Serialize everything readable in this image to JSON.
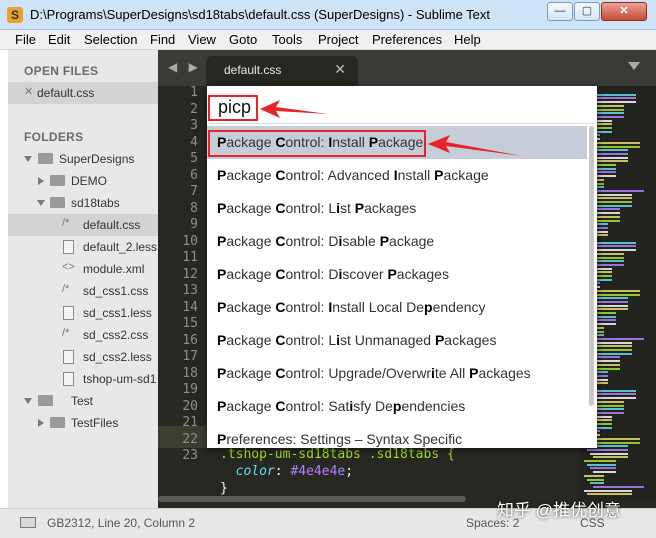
{
  "window": {
    "title": "D:\\Programs\\SuperDesigns\\sd18tabs\\default.css (SuperDesigns) - Sublime Text",
    "app_icon": "S",
    "min_glyph": "—",
    "max_glyph": "▢",
    "close_glyph": "✕"
  },
  "menu": [
    "File",
    "Edit",
    "Selection",
    "Find",
    "View",
    "Goto",
    "Tools",
    "Project",
    "Preferences",
    "Help"
  ],
  "sidebar": {
    "open_files_header": "OPEN FILES",
    "open_files": [
      {
        "label": "default.css",
        "glyph": "✕"
      }
    ],
    "folders_header": "FOLDERS",
    "tree": [
      {
        "label": "SuperDesigns",
        "kind": "folder",
        "expanded": true
      },
      {
        "label": "DEMO",
        "kind": "folder",
        "expanded": false
      },
      {
        "label": "sd18tabs",
        "kind": "folder",
        "expanded": true
      },
      {
        "label": "default.css",
        "kind": "css",
        "glyph": "/*"
      },
      {
        "label": "default_2.less",
        "kind": "file"
      },
      {
        "label": "module.xml",
        "kind": "xml",
        "glyph": "<>"
      },
      {
        "label": "sd_css1.css",
        "kind": "css",
        "glyph": "/*"
      },
      {
        "label": "sd_css1.less",
        "kind": "file"
      },
      {
        "label": "sd_css2.css",
        "kind": "css",
        "glyph": "/*"
      },
      {
        "label": "sd_css2.less",
        "kind": "file"
      },
      {
        "label": "tshop-um-sd1",
        "kind": "file"
      },
      {
        "label": "Test",
        "kind": "folder",
        "expanded": true
      },
      {
        "label": "TestFiles",
        "kind": "folder",
        "expanded": false
      }
    ]
  },
  "tabs": {
    "nav": "◀ ▶",
    "active": {
      "label": "default.css",
      "close": "✕"
    }
  },
  "editor": {
    "line_numbers": [
      "1",
      "2",
      "3",
      "4",
      "5",
      "6",
      "7",
      "8",
      "9",
      "10",
      "11",
      "12",
      "13",
      "14",
      "15",
      "16",
      "17",
      "18",
      "19",
      "20",
      "21",
      "22",
      "23"
    ],
    "current_line": "20",
    "code": {
      "line21_selector": ".tshop-um-sd18tabs .sd18tabs {",
      "line22_prop": "color",
      "line22_colon": ": ",
      "line22_value": "#4e4e4e",
      "line22_end": ";",
      "line23": "}"
    }
  },
  "palette": {
    "query": "picp",
    "items": [
      {
        "parts": [
          [
            "m",
            "P"
          ],
          [
            "",
            "ackage "
          ],
          [
            "m",
            "C"
          ],
          [
            "",
            "ontrol: "
          ],
          [
            "m",
            "I"
          ],
          [
            "",
            "nstall "
          ],
          [
            "m",
            "P"
          ],
          [
            "",
            "ackage"
          ]
        ]
      },
      {
        "parts": [
          [
            "m",
            "P"
          ],
          [
            "",
            "ackage "
          ],
          [
            "m",
            "C"
          ],
          [
            "",
            "ontrol: Advanced "
          ],
          [
            "m",
            "I"
          ],
          [
            "",
            "nstall "
          ],
          [
            "m",
            "P"
          ],
          [
            "",
            "ackage"
          ]
        ]
      },
      {
        "parts": [
          [
            "m",
            "P"
          ],
          [
            "",
            "ackage "
          ],
          [
            "m",
            "C"
          ],
          [
            "",
            "ontrol: L"
          ],
          [
            "m",
            "i"
          ],
          [
            "",
            "st "
          ],
          [
            "m",
            "P"
          ],
          [
            "",
            "ackages"
          ]
        ]
      },
      {
        "parts": [
          [
            "m",
            "P"
          ],
          [
            "",
            "ackage "
          ],
          [
            "m",
            "C"
          ],
          [
            "",
            "ontrol: D"
          ],
          [
            "m",
            "i"
          ],
          [
            "",
            "sable "
          ],
          [
            "m",
            "P"
          ],
          [
            "",
            "ackage"
          ]
        ]
      },
      {
        "parts": [
          [
            "m",
            "P"
          ],
          [
            "",
            "ackage "
          ],
          [
            "m",
            "C"
          ],
          [
            "",
            "ontrol: D"
          ],
          [
            "m",
            "i"
          ],
          [
            "",
            "scover "
          ],
          [
            "m",
            "P"
          ],
          [
            "",
            "ackages"
          ]
        ]
      },
      {
        "parts": [
          [
            "m",
            "P"
          ],
          [
            "",
            "ackage "
          ],
          [
            "m",
            "C"
          ],
          [
            "",
            "ontrol: "
          ],
          [
            "m",
            "I"
          ],
          [
            "",
            "nstall Local De"
          ],
          [
            "m",
            "p"
          ],
          [
            "",
            "endency"
          ]
        ]
      },
      {
        "parts": [
          [
            "m",
            "P"
          ],
          [
            "",
            "ackage "
          ],
          [
            "m",
            "C"
          ],
          [
            "",
            "ontrol: L"
          ],
          [
            "m",
            "i"
          ],
          [
            "",
            "st Unmanaged "
          ],
          [
            "m",
            "P"
          ],
          [
            "",
            "ackages"
          ]
        ]
      },
      {
        "parts": [
          [
            "m",
            "P"
          ],
          [
            "",
            "ackage "
          ],
          [
            "m",
            "C"
          ],
          [
            "",
            "ontrol: Upgrade/Overwr"
          ],
          [
            "m",
            "i"
          ],
          [
            "",
            "te All "
          ],
          [
            "m",
            "P"
          ],
          [
            "",
            "ackages"
          ]
        ]
      },
      {
        "parts": [
          [
            "m",
            "P"
          ],
          [
            "",
            "ackage "
          ],
          [
            "m",
            "C"
          ],
          [
            "",
            "ontrol: Sat"
          ],
          [
            "m",
            "i"
          ],
          [
            "",
            "sfy De"
          ],
          [
            "m",
            "p"
          ],
          [
            "",
            "endencies"
          ]
        ]
      },
      {
        "parts": [
          [
            "m",
            "P"
          ],
          [
            "",
            "references: Settings – Syntax Specific"
          ]
        ]
      }
    ],
    "selected_index": 0
  },
  "status": {
    "encoding_line": "GB2312, Line 20, Column 2",
    "spaces": "Spaces: 2",
    "syntax": "CSS"
  },
  "watermark": "知乎 @推优创意",
  "colors": {
    "annotation": "#e8232a",
    "editor_bg": "#272822",
    "selector": "#a6e22e",
    "property": "#66d9ef",
    "value": "#ae81ff"
  }
}
